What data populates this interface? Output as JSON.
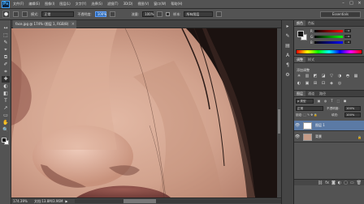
{
  "app": {
    "logo": "Ps"
  },
  "menu": [
    "文件(F)",
    "编辑(E)",
    "图像(I)",
    "图层(L)",
    "文字(Y)",
    "选择(S)",
    "滤镜(T)",
    "3D(D)",
    "视图(V)",
    "窗口(W)",
    "帮助(H)"
  ],
  "window_controls": [
    "–",
    "□",
    "×"
  ],
  "options": {
    "brush_size": "●",
    "mode_label": "模式:",
    "mode_value": "正常",
    "opacity_label": "不透明度:",
    "opacity_value": "100%",
    "flow_label": "流量:",
    "flow_value": "100%",
    "sample_label": "样本:",
    "sample_value": "所有图层",
    "workspace": "Essentials"
  },
  "document_tab": {
    "title": "face.jpg @ 174% (图层 1, RGB/8)",
    "close": "×"
  },
  "tools": [
    "↔",
    "⬚",
    "✎",
    "⌖",
    "⧉",
    "✐",
    "⌗",
    "✚",
    "◐",
    "◧",
    "T",
    "↗",
    "▭",
    "✋",
    "🔍"
  ],
  "status": {
    "zoom": "174.39%",
    "doc": "文档:13.8M/3.96M",
    "arrow": "▶"
  },
  "panel_strip_icons": [
    "▸",
    "✎",
    "▤",
    "A",
    "¶",
    "⚙"
  ],
  "color_panel": {
    "tabs": [
      "颜色",
      "色板"
    ],
    "rows": [
      {
        "label": "R",
        "value": "0"
      },
      {
        "label": "G",
        "value": "0"
      },
      {
        "label": "B",
        "value": "0"
      }
    ]
  },
  "adjustments_panel": {
    "tabs": [
      "调整",
      "样式"
    ],
    "title": "添加调整",
    "icons": [
      "☀",
      "▥",
      "◩",
      "◪",
      "▽",
      "◑",
      "◓",
      "▦",
      "◐",
      "▣",
      "⊞",
      "⊡",
      "◈",
      "◎"
    ]
  },
  "layers_panel": {
    "tabs": [
      "图层",
      "通道",
      "路径"
    ],
    "search": "ρ 类型",
    "filter_icons": [
      "▣",
      "◍",
      "T",
      "⬚",
      "◼"
    ],
    "blend": "正常",
    "opacity_label": "不透明度:",
    "opacity": "100%",
    "lock_label": "锁定: ⬚ ✎ ✥ 🔒",
    "fill_label": "填充:",
    "fill": "100%",
    "layers": [
      {
        "name": "图层 1",
        "selected": true,
        "visible": true
      },
      {
        "name": "背景",
        "selected": false,
        "visible": true
      }
    ],
    "bottom_icons": [
      "⛓",
      "fx",
      "◙",
      "◐",
      "▢",
      "▭",
      "🗑"
    ]
  },
  "colors": {
    "menubar_bg": "#535353",
    "panel_bg": "#535353",
    "selected_layer": "#5b7aa5",
    "skin": "#c99a86",
    "active_field": "#2a69b8"
  }
}
